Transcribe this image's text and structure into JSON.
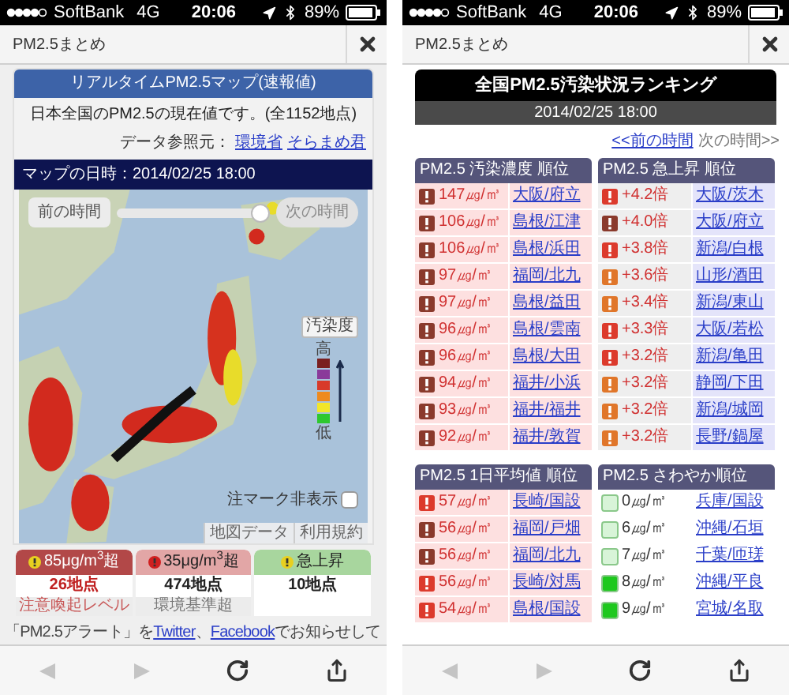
{
  "map_screen": {
    "status_bar": {
      "carrier": "SoftBank",
      "network": "4G",
      "time": "20:06",
      "battery": "89%"
    },
    "title_bar": {
      "title": "PM2.5まとめ"
    },
    "map_card": {
      "title": "リアルタイムPM2.5マップ(速報値)",
      "summary": "日本全国のPM2.5の現在値です。(全1152地点)",
      "source_label": "データ参照元：",
      "source_links": [
        "環境省",
        "そらまめ君"
      ],
      "datetime_label": "マップの日時：",
      "datetime": "2014/02/25 18:00"
    },
    "map": {
      "prev_button": {
        "label": "前の時間"
      },
      "next_button": {
        "label": "次の時間",
        "disabled": true
      },
      "slider": {
        "level": 1
      },
      "legend": {
        "title": "汚染度",
        "high": "高",
        "low": "低",
        "colors": [
          {
            "color": "#7a1f1f"
          },
          {
            "color": "#8a3a9a"
          },
          {
            "color": "#d83a2a"
          },
          {
            "color": "#ee8a1e"
          },
          {
            "color": "#f2e62a"
          },
          {
            "color": "#2ec82e"
          }
        ]
      },
      "hide_marks": {
        "label": "注マーク非表示",
        "checked": false
      },
      "footer_links": [
        "地図データ",
        "利用規約"
      ]
    },
    "stats": [
      {
        "title": "85μg/m$^{3}$超",
        "count": "26地点",
        "note": "注意喚起レベル",
        "color": "#b24848"
      },
      {
        "title": "35μg/m$^{3}$超",
        "count": "474地点",
        "note": "環境基準超",
        "color": "#e2a6a6"
      },
      {
        "title": "急上昇",
        "count": "10地点",
        "color": "#a8d69e"
      }
    ],
    "alert_text": {
      "before": "「PM2.5アラート」を",
      "links": [
        "Twitter",
        "Facebook"
      ],
      "separator": "、",
      "after": "でお知らせして"
    },
    "toolbar": {
      "back_disabled": true,
      "forward_disabled": true
    }
  },
  "ranking_screen": {
    "status_bar": {
      "carrier": "SoftBank",
      "network": "4G",
      "time": "20:06",
      "battery": "89%"
    },
    "title_bar": {
      "title": "PM2.5まとめ"
    },
    "header": {
      "title": "全国PM2.5汚染状況ランキング",
      "datetime": "2014/02/25 18:00"
    },
    "nav": {
      "prev": "<<前の時間",
      "next": "次の時間>>"
    },
    "tables": [
      {
        "title": "PM2.5 汚染濃度 順位",
        "kind": "concentration",
        "rows": [
          {
            "value": "147㎍/㎥",
            "place": "大阪/府立",
            "color": "#8a3a2c"
          },
          {
            "value": "106㎍/㎥",
            "place": "島根/江津",
            "color": "#8a3a2c"
          },
          {
            "value": "106㎍/㎥",
            "place": "島根/浜田",
            "color": "#8a3a2c"
          },
          {
            "value": "97㎍/㎥",
            "place": "福岡/北九",
            "color": "#8a3a2c"
          },
          {
            "value": "97㎍/㎥",
            "place": "島根/益田",
            "color": "#8a3a2c"
          },
          {
            "value": "96㎍/㎥",
            "place": "島根/雲南",
            "color": "#8a3a2c"
          },
          {
            "value": "96㎍/㎥",
            "place": "島根/大田",
            "color": "#8a3a2c"
          },
          {
            "value": "94㎍/㎥",
            "place": "福井/小浜",
            "color": "#8a3a2c"
          },
          {
            "value": "93㎍/㎥",
            "place": "福井/福井",
            "color": "#8a3a2c"
          },
          {
            "value": "92㎍/㎥",
            "place": "福井/敦賀",
            "color": "#8a3a2c"
          }
        ]
      },
      {
        "title": "PM2.5 急上昇 順位",
        "kind": "rise",
        "rows": [
          {
            "value": "+4.2倍",
            "place": "大阪/茨木",
            "color": "#dc3a2c"
          },
          {
            "value": "+4.0倍",
            "place": "大阪/府立",
            "color": "#8a3a2c"
          },
          {
            "value": "+3.8倍",
            "place": "新潟/白根",
            "color": "#dc3a2c"
          },
          {
            "value": "+3.6倍",
            "place": "山形/酒田",
            "color": "#e0762a"
          },
          {
            "value": "+3.4倍",
            "place": "新潟/東山",
            "color": "#e0762a"
          },
          {
            "value": "+3.3倍",
            "place": "大阪/若松",
            "color": "#dc3a2c"
          },
          {
            "value": "+3.2倍",
            "place": "新潟/亀田",
            "color": "#dc3a2c"
          },
          {
            "value": "+3.2倍",
            "place": "静岡/下田",
            "color": "#e0762a"
          },
          {
            "value": "+3.2倍",
            "place": "新潟/城岡",
            "color": "#e0762a"
          },
          {
            "value": "+3.2倍",
            "place": "長野/鍋屋",
            "color": "#e0762a"
          }
        ]
      },
      {
        "title": "PM2.5 1日平均値 順位",
        "kind": "concentration",
        "rows": [
          {
            "value": "57㎍/㎥",
            "place": "長崎/国設",
            "color": "#dc3a2c"
          },
          {
            "value": "56㎍/㎥",
            "place": "福岡/戸畑",
            "color": "#8a3a2c"
          },
          {
            "value": "56㎍/㎥",
            "place": "福岡/北九",
            "color": "#8a3a2c"
          },
          {
            "value": "56㎍/㎥",
            "place": "長崎/対馬",
            "color": "#dc3a2c"
          },
          {
            "value": "54㎍/㎥",
            "place": "島根/国設",
            "color": "#dc3a2c"
          }
        ]
      },
      {
        "title": "PM2.5 さわやか順位",
        "kind": "fresh",
        "rows": [
          {
            "value": "0㎍/㎥",
            "place": "兵庫/国設",
            "color": "#d8f4d8"
          },
          {
            "value": "6㎍/㎥",
            "place": "沖縄/石垣",
            "color": "#d8f4d8"
          },
          {
            "value": "7㎍/㎥",
            "place": "千葉/匝瑳",
            "color": "#d8f4d8"
          },
          {
            "value": "8㎍/㎥",
            "place": "沖縄/平良",
            "color": "#1ec81e"
          },
          {
            "value": "9㎍/㎥",
            "place": "宮城/名取",
            "color": "#1ec81e"
          }
        ]
      }
    ],
    "toolbar": {
      "back_disabled": true,
      "forward_disabled": true
    }
  }
}
